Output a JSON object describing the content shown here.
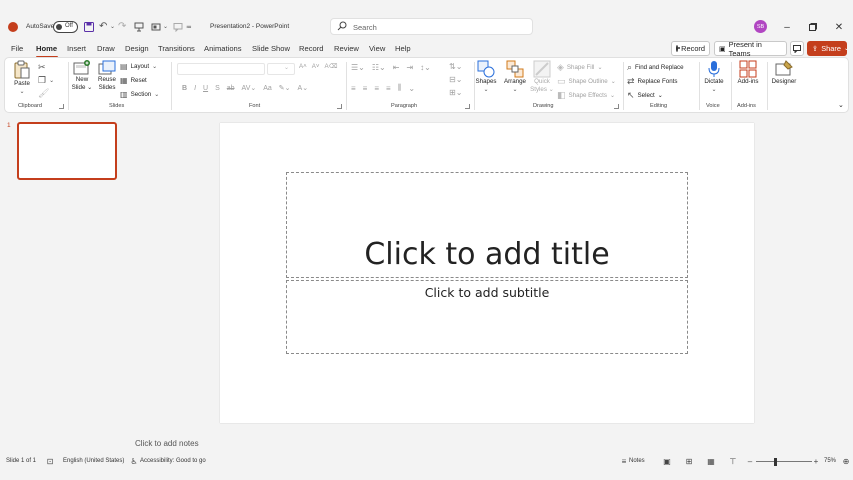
{
  "titlebar": {
    "autosave_label": "AutoSave",
    "autosave_state": "Off",
    "doc_title": "Presentation2 - PowerPoint",
    "search_placeholder": "Search",
    "avatar_initials": "SB",
    "accent_color": "#c43e1c"
  },
  "menu": {
    "tabs": [
      "File",
      "Home",
      "Insert",
      "Draw",
      "Design",
      "Transitions",
      "Animations",
      "Slide Show",
      "Record",
      "Review",
      "View",
      "Help"
    ],
    "active_tab": "Home",
    "record_label": "Record",
    "teams_label": "Present in Teams",
    "share_label": "Share"
  },
  "ribbon": {
    "clipboard": {
      "paste": "Paste",
      "group": "Clipboard"
    },
    "slides": {
      "new_slide": "New Slide",
      "reuse": "Reuse Slides",
      "layout": "Layout",
      "reset": "Reset",
      "section": "Section",
      "group": "Slides"
    },
    "font": {
      "group": "Font",
      "bold": "B",
      "italic": "I",
      "underline": "U",
      "strike": "S",
      "case": "Aa"
    },
    "paragraph": {
      "group": "Paragraph"
    },
    "drawing": {
      "shapes": "Shapes",
      "arrange": "Arrange",
      "quick_styles": "Quick Styles",
      "shape_fill": "Shape Fill",
      "shape_outline": "Shape Outline",
      "shape_effects": "Shape Effects",
      "group": "Drawing"
    },
    "editing": {
      "find": "Find and Replace",
      "replace": "Replace Fonts",
      "select": "Select",
      "group": "Editing"
    },
    "voice": {
      "dictate": "Dictate",
      "group": "Voice"
    },
    "addins": {
      "addins": "Add-ins",
      "group": "Add-ins"
    },
    "designer": {
      "label": "Designer"
    }
  },
  "slides_pane": {
    "slide_number": "1"
  },
  "slide": {
    "title_placeholder": "Click to add title",
    "subtitle_placeholder": "Click to add subtitle"
  },
  "notes_placeholder": "Click to add notes",
  "statusbar": {
    "slide_count": "Slide 1 of 1",
    "language": "English (United States)",
    "accessibility": "Accessibility: Good to go",
    "notes_label": "Notes",
    "zoom": "75%"
  }
}
